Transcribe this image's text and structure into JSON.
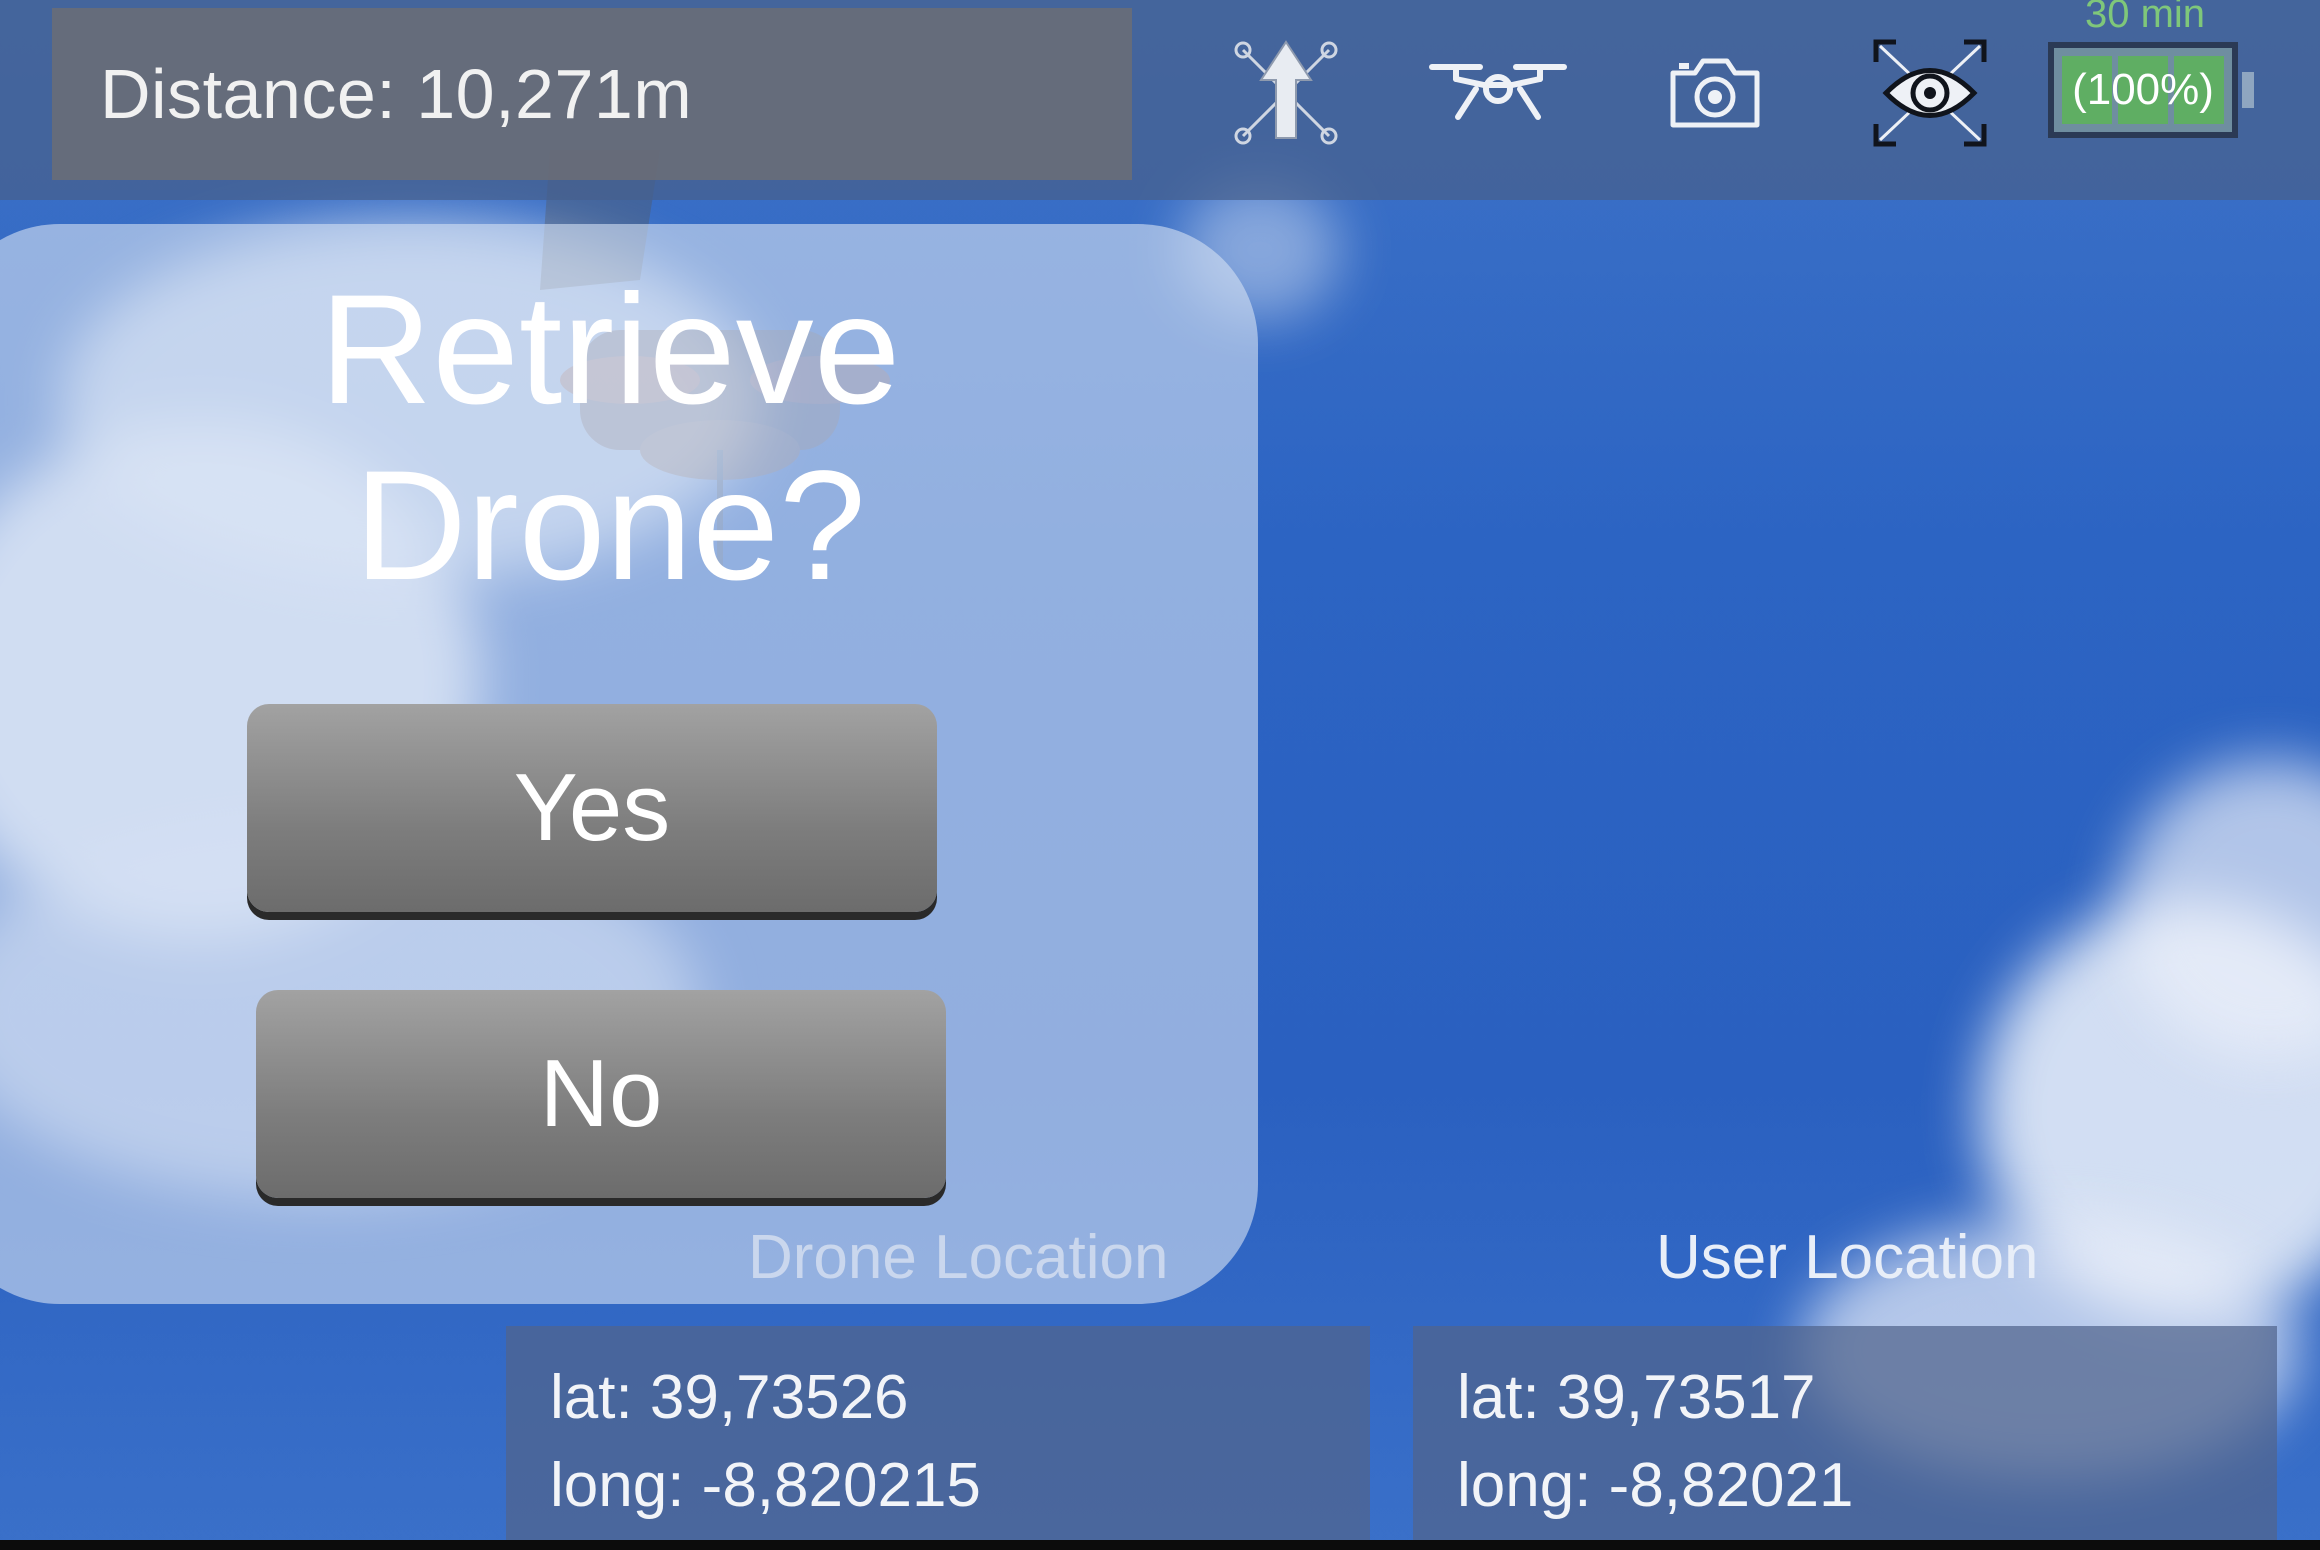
{
  "header": {
    "distance_text": "Distance: 10,271m",
    "icons": [
      "move-up-icon",
      "drone-icon",
      "camera-icon",
      "view-icon"
    ],
    "battery": {
      "percent_text": "(100%)",
      "level": 1.0,
      "time_left": "30 min",
      "fill_color": "#5fae63"
    }
  },
  "dialog": {
    "title_line1": "Retrieve",
    "title_line2": "Drone?",
    "yes_label": "Yes",
    "no_label": "No"
  },
  "locations": {
    "drone": {
      "label": "Drone Location",
      "lat": "lat: 39,73526",
      "long": "long: -8,820215"
    },
    "user": {
      "label": "User Location",
      "lat": "lat: 39,73517",
      "long": "long: -8,82021"
    }
  }
}
